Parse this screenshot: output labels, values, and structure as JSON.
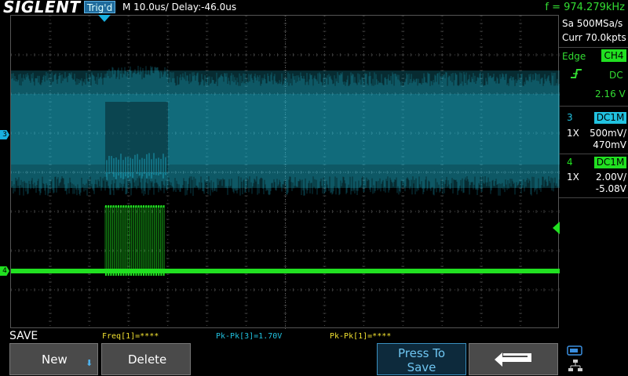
{
  "topbar": {
    "logo": "SIGLENT",
    "trigger_status": "Trig'd",
    "timebase": "M 10.0us/  Delay:-46.0us",
    "frequency": "f = 974.279kHz"
  },
  "acquisition": {
    "sample_rate": "Sa 500MSa/s",
    "memory": "Curr 70.0kpts"
  },
  "trigger": {
    "type": "Edge",
    "source": "CH4",
    "coupling": "DC",
    "level": "2.16 V"
  },
  "channels": [
    {
      "number": "3",
      "coupling": "DC1M",
      "probe": "1X",
      "scale": "500mV/",
      "offset": "470mV",
      "color": "#21c2e0"
    },
    {
      "number": "4",
      "coupling": "DC1M",
      "probe": "1X",
      "scale": "2.00V/",
      "offset": "-5.08V",
      "color": "#21e021"
    }
  ],
  "markers": {
    "ch3": "3",
    "ch4": "4"
  },
  "menu_title": "SAVE",
  "measurements": [
    {
      "text": "Freq[1]=****",
      "color": "#f0e030"
    },
    {
      "text": "Pk-Pk[3]=1.70V",
      "color": "#21c2e0"
    },
    {
      "text": "Pk-Pk[1]=****",
      "color": "#f0e030"
    }
  ],
  "softkeys": {
    "new": "New",
    "delete": "Delete",
    "press_to_save_1": "Press To",
    "press_to_save_2": "Save"
  },
  "icons": [
    "down-arrow-icon",
    "return-icon",
    "usb-icon",
    "network-icon"
  ]
}
